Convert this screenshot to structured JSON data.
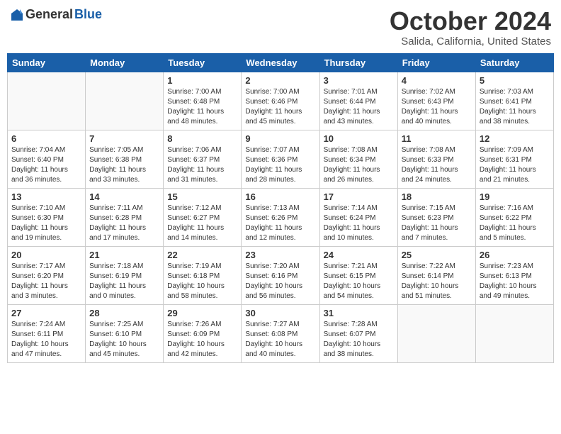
{
  "header": {
    "logo_general": "General",
    "logo_blue": "Blue",
    "month_title": "October 2024",
    "location": "Salida, California, United States"
  },
  "weekdays": [
    "Sunday",
    "Monday",
    "Tuesday",
    "Wednesday",
    "Thursday",
    "Friday",
    "Saturday"
  ],
  "rows": [
    [
      {
        "day": "",
        "info": ""
      },
      {
        "day": "",
        "info": ""
      },
      {
        "day": "1",
        "info": "Sunrise: 7:00 AM\nSunset: 6:48 PM\nDaylight: 11 hours and 48 minutes."
      },
      {
        "day": "2",
        "info": "Sunrise: 7:00 AM\nSunset: 6:46 PM\nDaylight: 11 hours and 45 minutes."
      },
      {
        "day": "3",
        "info": "Sunrise: 7:01 AM\nSunset: 6:44 PM\nDaylight: 11 hours and 43 minutes."
      },
      {
        "day": "4",
        "info": "Sunrise: 7:02 AM\nSunset: 6:43 PM\nDaylight: 11 hours and 40 minutes."
      },
      {
        "day": "5",
        "info": "Sunrise: 7:03 AM\nSunset: 6:41 PM\nDaylight: 11 hours and 38 minutes."
      }
    ],
    [
      {
        "day": "6",
        "info": "Sunrise: 7:04 AM\nSunset: 6:40 PM\nDaylight: 11 hours and 36 minutes."
      },
      {
        "day": "7",
        "info": "Sunrise: 7:05 AM\nSunset: 6:38 PM\nDaylight: 11 hours and 33 minutes."
      },
      {
        "day": "8",
        "info": "Sunrise: 7:06 AM\nSunset: 6:37 PM\nDaylight: 11 hours and 31 minutes."
      },
      {
        "day": "9",
        "info": "Sunrise: 7:07 AM\nSunset: 6:36 PM\nDaylight: 11 hours and 28 minutes."
      },
      {
        "day": "10",
        "info": "Sunrise: 7:08 AM\nSunset: 6:34 PM\nDaylight: 11 hours and 26 minutes."
      },
      {
        "day": "11",
        "info": "Sunrise: 7:08 AM\nSunset: 6:33 PM\nDaylight: 11 hours and 24 minutes."
      },
      {
        "day": "12",
        "info": "Sunrise: 7:09 AM\nSunset: 6:31 PM\nDaylight: 11 hours and 21 minutes."
      }
    ],
    [
      {
        "day": "13",
        "info": "Sunrise: 7:10 AM\nSunset: 6:30 PM\nDaylight: 11 hours and 19 minutes."
      },
      {
        "day": "14",
        "info": "Sunrise: 7:11 AM\nSunset: 6:28 PM\nDaylight: 11 hours and 17 minutes."
      },
      {
        "day": "15",
        "info": "Sunrise: 7:12 AM\nSunset: 6:27 PM\nDaylight: 11 hours and 14 minutes."
      },
      {
        "day": "16",
        "info": "Sunrise: 7:13 AM\nSunset: 6:26 PM\nDaylight: 11 hours and 12 minutes."
      },
      {
        "day": "17",
        "info": "Sunrise: 7:14 AM\nSunset: 6:24 PM\nDaylight: 11 hours and 10 minutes."
      },
      {
        "day": "18",
        "info": "Sunrise: 7:15 AM\nSunset: 6:23 PM\nDaylight: 11 hours and 7 minutes."
      },
      {
        "day": "19",
        "info": "Sunrise: 7:16 AM\nSunset: 6:22 PM\nDaylight: 11 hours and 5 minutes."
      }
    ],
    [
      {
        "day": "20",
        "info": "Sunrise: 7:17 AM\nSunset: 6:20 PM\nDaylight: 11 hours and 3 minutes."
      },
      {
        "day": "21",
        "info": "Sunrise: 7:18 AM\nSunset: 6:19 PM\nDaylight: 11 hours and 0 minutes."
      },
      {
        "day": "22",
        "info": "Sunrise: 7:19 AM\nSunset: 6:18 PM\nDaylight: 10 hours and 58 minutes."
      },
      {
        "day": "23",
        "info": "Sunrise: 7:20 AM\nSunset: 6:16 PM\nDaylight: 10 hours and 56 minutes."
      },
      {
        "day": "24",
        "info": "Sunrise: 7:21 AM\nSunset: 6:15 PM\nDaylight: 10 hours and 54 minutes."
      },
      {
        "day": "25",
        "info": "Sunrise: 7:22 AM\nSunset: 6:14 PM\nDaylight: 10 hours and 51 minutes."
      },
      {
        "day": "26",
        "info": "Sunrise: 7:23 AM\nSunset: 6:13 PM\nDaylight: 10 hours and 49 minutes."
      }
    ],
    [
      {
        "day": "27",
        "info": "Sunrise: 7:24 AM\nSunset: 6:11 PM\nDaylight: 10 hours and 47 minutes."
      },
      {
        "day": "28",
        "info": "Sunrise: 7:25 AM\nSunset: 6:10 PM\nDaylight: 10 hours and 45 minutes."
      },
      {
        "day": "29",
        "info": "Sunrise: 7:26 AM\nSunset: 6:09 PM\nDaylight: 10 hours and 42 minutes."
      },
      {
        "day": "30",
        "info": "Sunrise: 7:27 AM\nSunset: 6:08 PM\nDaylight: 10 hours and 40 minutes."
      },
      {
        "day": "31",
        "info": "Sunrise: 7:28 AM\nSunset: 6:07 PM\nDaylight: 10 hours and 38 minutes."
      },
      {
        "day": "",
        "info": ""
      },
      {
        "day": "",
        "info": ""
      }
    ]
  ]
}
